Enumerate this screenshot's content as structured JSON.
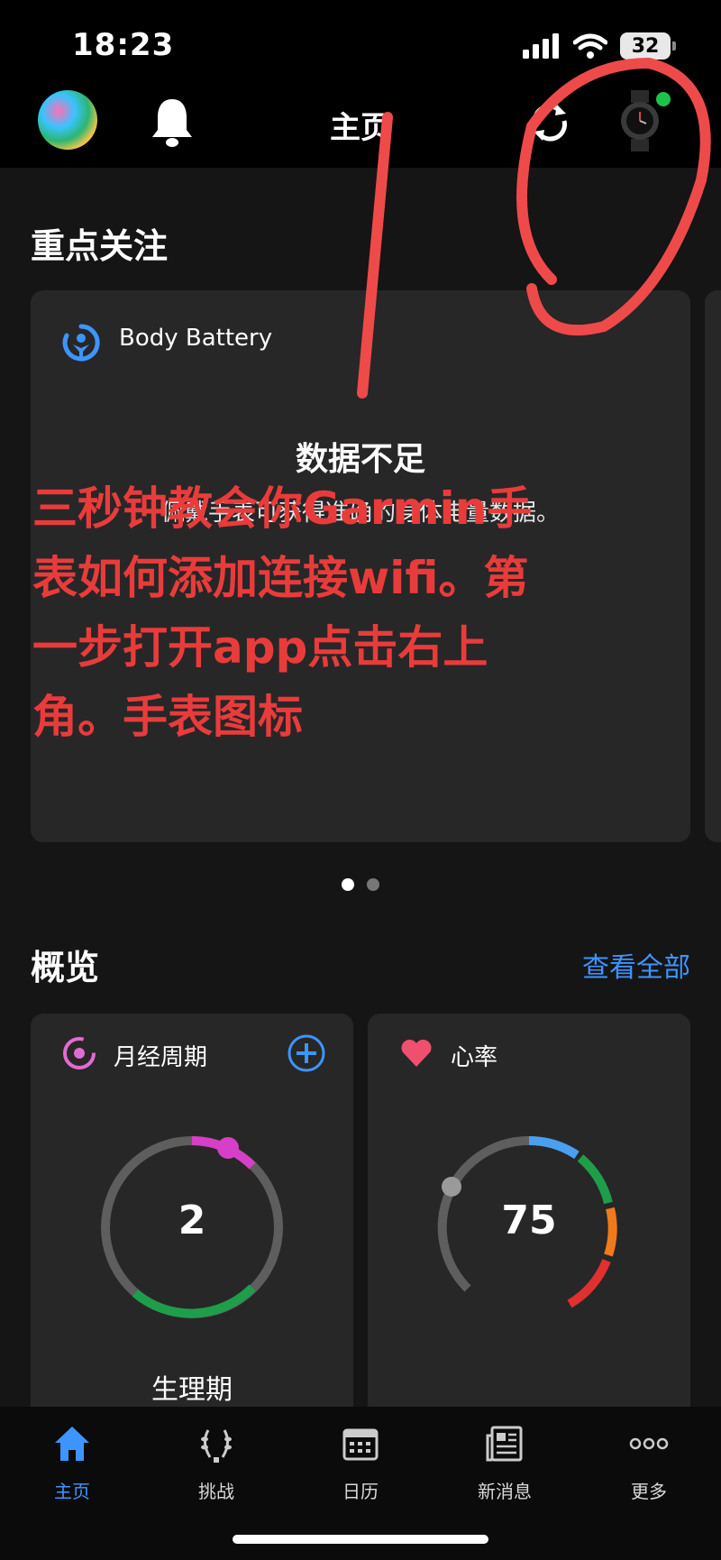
{
  "status_bar": {
    "time": "18:23",
    "battery": "32"
  },
  "header": {
    "title": "主页"
  },
  "focus": {
    "section_title": "重点关注",
    "card": {
      "label": "Body Battery",
      "title": "数据不足",
      "description": "佩戴手表可获得准确的身体电量数据。"
    }
  },
  "overview": {
    "section_title": "概览",
    "view_all": "查看全部",
    "cards": [
      {
        "label": "月经周期",
        "value": "2",
        "sub": "生理期"
      },
      {
        "label": "心率",
        "value": "75"
      }
    ]
  },
  "overlay": {
    "text": "三秒钟教会你Garmin手表如何添加连接wifi。第一步打开app点击右上角。手表图标"
  },
  "nav": [
    {
      "label": "主页",
      "icon": "home-icon",
      "active": true
    },
    {
      "label": "挑战",
      "icon": "laurel-icon"
    },
    {
      "label": "日历",
      "icon": "calendar-icon"
    },
    {
      "label": "新消息",
      "icon": "newspaper-icon"
    },
    {
      "label": "更多",
      "icon": "more-icon"
    }
  ],
  "colors": {
    "accent": "#3d95ff",
    "annotation": "#ea3b3b",
    "card": "#272727",
    "background": "#151515"
  }
}
